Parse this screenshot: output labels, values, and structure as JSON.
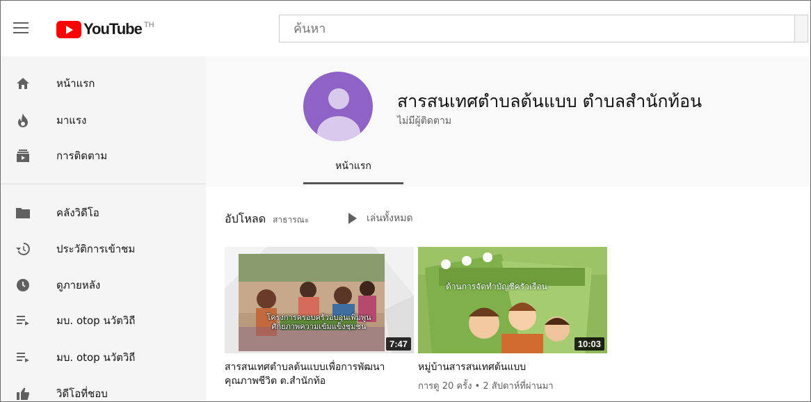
{
  "header": {
    "logo_text": "YouTube",
    "logo_region": "TH",
    "search_placeholder": "ค้นหา"
  },
  "sidebar": {
    "items": [
      {
        "label": "หน้าแรก",
        "icon": "home-icon"
      },
      {
        "label": "มาแรง",
        "icon": "trending-icon"
      },
      {
        "label": "การติดตาม",
        "icon": "subscriptions-icon"
      },
      {
        "label": "คลังวิดีโอ",
        "icon": "library-icon"
      },
      {
        "label": "ประวัติการเข้าชม",
        "icon": "history-icon"
      },
      {
        "label": "ดูภายหลัง",
        "icon": "watch-later-icon"
      },
      {
        "label": "มบ. otop นวัตวิถี",
        "icon": "playlist-icon"
      },
      {
        "label": "มบ. otop นวัตวิถี",
        "icon": "playlist-icon"
      },
      {
        "label": "วิดีโอที่ชอบ",
        "icon": "like-icon"
      }
    ]
  },
  "channel": {
    "title": "สารสนเทศตำบลต้นแบบ ตำบลสำนักท้อน",
    "subscribers": "ไม่มีผู้ติดตาม",
    "tab_home": "หน้าแรก"
  },
  "uploads": {
    "title": "อัปโหลด",
    "visibility": "สาธารณะ",
    "play_all": "เล่นทั้งหมด",
    "videos": [
      {
        "title": "สารสนเทศตำบลต้นแบบเพื่อการพัฒนาคุณภาพชีวิต ต.สำนักท้อ",
        "duration": "7:47",
        "meta": "",
        "thumb_caption_1": "โครงการครอบครัวอบอุ่นเพิ่มพูน",
        "thumb_caption_2": "ศักยภาพความเข้มแข็งชุมชน"
      },
      {
        "title": "หมู่บ้านสารสนเทศต้นแบบ",
        "duration": "10:03",
        "meta": "การดู 20 ครั้ง • 2 สัปดาห์ที่ผ่านมา",
        "thumb_caption_1": "ด้านการจัดทำบัญชีครัวเรือน"
      }
    ]
  }
}
